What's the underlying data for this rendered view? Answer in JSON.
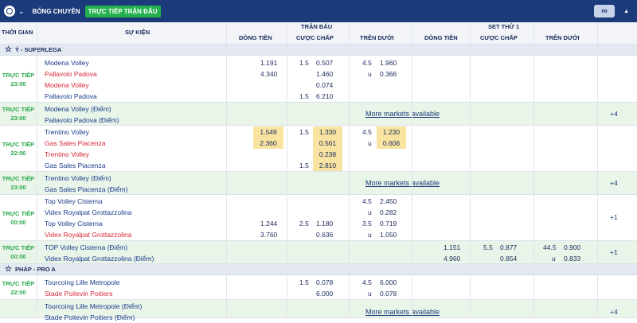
{
  "topbar": {
    "sport": "BÓNG CHUYỀN",
    "live_tab": "TRỰC TIẾP TRẬN ĐẤU",
    "toggle": "∞"
  },
  "header": {
    "time": "THỜI GIAN",
    "event": "SỰ KIỆN",
    "match": "TRẬN ĐẤU",
    "set1": "SET THỨ 1",
    "money": "DÒNG TIỀN",
    "handicap": "CƯỢC CHẤP",
    "overunder": "TRÊN DƯỚI"
  },
  "leagues": [
    {
      "name": "Ý - SUPERLEGA"
    },
    {
      "name": "PHÁP - PRO A"
    }
  ],
  "more_label": "More markets available",
  "matches": [
    {
      "live": "TRỰC TIẾP",
      "time": "23:00",
      "rows": [
        {
          "home": "Modena Volley",
          "away": "Pallavolo Padova",
          "ml": [
            "1.191",
            "4.340"
          ],
          "hcap_line": "1.5",
          "hcap": [
            "0.507",
            "1.460"
          ],
          "ou_line": "4.5",
          "ou_u": "u",
          "ou": [
            "1.960",
            "0.366"
          ]
        },
        {
          "home": "Modena Volley",
          "away": "Pallavolo Padova",
          "hcap_line": "1.5",
          "hcap": [
            "0.074",
            "6.210"
          ]
        }
      ]
    },
    {
      "live": "TRỰC TIẾP",
      "time": "23:00",
      "home": "Modena Volley (Điểm)",
      "away": "Pallavolo Padova (Điểm)",
      "plus": "+4"
    },
    {
      "live": "TRỰC TIẾP",
      "time": "22:00",
      "rows": [
        {
          "home": "Trentino Volley",
          "away": "Gas Sales Piacenza",
          "ml": [
            "1.549",
            "2.360"
          ],
          "hcap_line": "1.5",
          "hcap": [
            "1.330",
            "0.561"
          ],
          "ou_line": "4.5",
          "ou_u": "u",
          "ou": [
            "1.230",
            "0.606"
          ]
        },
        {
          "home": "Trentino Volley",
          "away": "Gas Sales Piacenza",
          "hcap_line": "1.5",
          "hcap": [
            "0.238",
            "2.810"
          ]
        }
      ]
    },
    {
      "live": "TRỰC TIẾP",
      "time": "23:00",
      "home": "Trentino Volley (Điểm)",
      "away": "Gas Sales Piacenza (Điểm)",
      "plus": "+4"
    },
    {
      "live": "TRỰC TIẾP",
      "time": "00:00",
      "plus": "+1",
      "rows": [
        {
          "home": "Top Volley Cisterna",
          "away": "Videx Royalpat Grottazzolina",
          "ou_line": "4.5",
          "ou_u": "u",
          "ou": [
            "2.450",
            "0.282"
          ]
        },
        {
          "home": "Top Volley Cisterna",
          "away": "Videx Royalpat Grottazzolina",
          "ml": [
            "1.244",
            "3.760"
          ],
          "hcap_line": "2.5",
          "hcap": [
            "1.180",
            "0.636"
          ],
          "ou_line": "3.5",
          "ou_u": "u",
          "ou": [
            "0.719",
            "1.050"
          ]
        }
      ]
    },
    {
      "live": "TRỰC TIẾP",
      "time": "00:00",
      "home": "TOP Volley Cisterna (Điểm)",
      "away": "Videx Royalpat Grottazzolina (Điểm)",
      "plus": "+1",
      "set_ml": [
        "1.151",
        "4.960"
      ],
      "set_hcap_line": "5.5",
      "set_hcap": [
        "0.877",
        "0.854"
      ],
      "set_ou_line": "44.5",
      "set_ou_u": "u",
      "set_ou": [
        "0.900",
        "0.833"
      ]
    },
    {
      "live": "TRỰC TIẾP",
      "time": "22:00",
      "home": "Tourcoing Lille Metropole",
      "away": "Stade Poitevin Poitiers",
      "hcap_line": "1.5",
      "hcap": [
        "0.078",
        "6.000"
      ],
      "ou_line": "4.5",
      "ou_u": "u",
      "ou": [
        "6.000",
        "0.078"
      ]
    },
    {
      "home": "Tourcoing Lille Metropole (Điểm)",
      "away": "Stade Poitevin Poitiers (Điểm)",
      "plus": "+4"
    }
  ]
}
